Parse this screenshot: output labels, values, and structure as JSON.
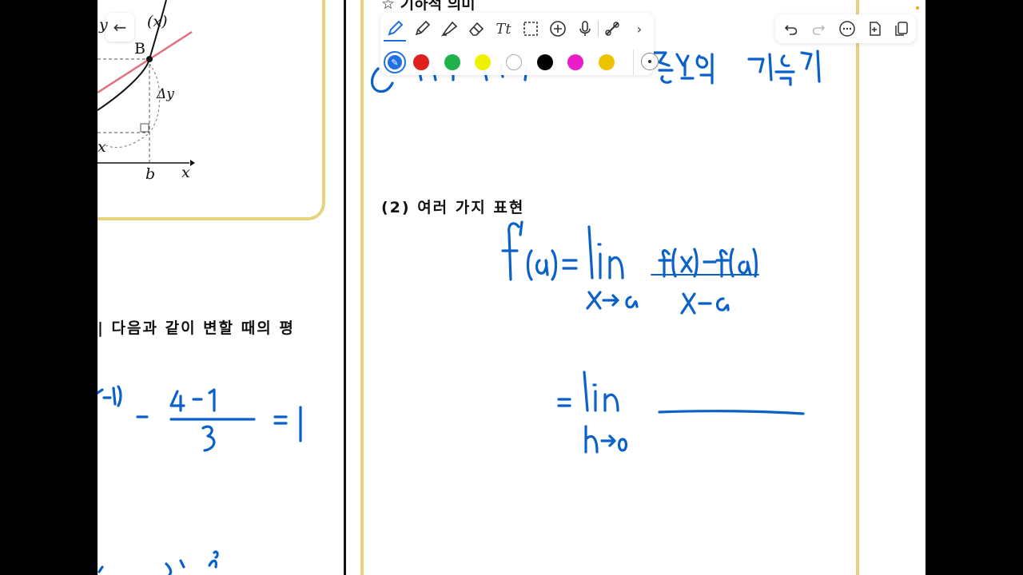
{
  "left_page": {
    "graph": {
      "point_label": "B",
      "func_label": "(x)",
      "delta_y": "Δy",
      "delta_x_partial": "x",
      "tick_b": "b",
      "axis_x": "x",
      "partial_y": "y"
    },
    "problem_text": "| 다음과 같이 변할 때의 평"
  },
  "right_page": {
    "heading_partial": "☆ 기하적 의미",
    "section_title": "(2) 여러 가지 표현"
  },
  "toolbar": {
    "tools": [
      "pen-icon",
      "marker-icon",
      "highlighter-icon",
      "eraser-icon",
      "text-icon",
      "lasso-icon",
      "add-icon",
      "microphone-icon",
      "link-icon",
      "chevron-right-icon"
    ],
    "colors": [
      "#1f6fe5",
      "#e0201c",
      "#1fb24a",
      "#eef200",
      "#ffffff",
      "#000000",
      "#e91ec8",
      "#eec400"
    ],
    "selected_color": "#1f6fe5"
  },
  "right_toolbar": {
    "tools": [
      "undo-icon",
      "redo-icon",
      "more-icon",
      "export-icon",
      "copy-icon"
    ]
  },
  "back_arrow": "←"
}
